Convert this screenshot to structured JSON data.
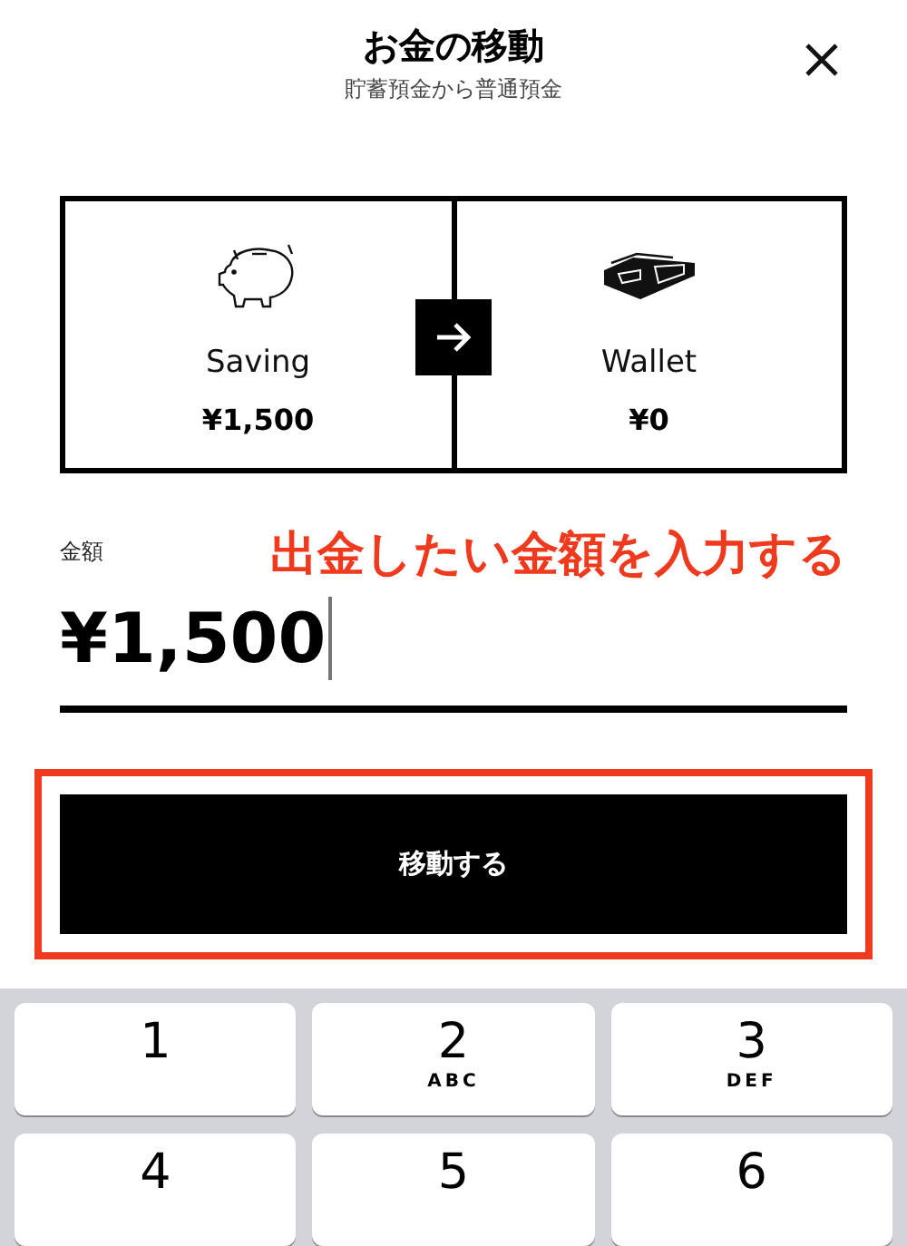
{
  "header": {
    "title": "お金の移動",
    "subtitle": "貯蓄預金から普通預金"
  },
  "transfer": {
    "from": {
      "name": "Saving",
      "amount": "¥1,500"
    },
    "to": {
      "name": "Wallet",
      "amount": "¥0"
    }
  },
  "amount_field": {
    "label": "金額",
    "value": "¥1,500"
  },
  "annotation": {
    "text": "出金したい金額を入力する"
  },
  "submit_button": {
    "label": "移動する"
  },
  "keypad": [
    {
      "digit": "1"
    },
    {
      "digit": "2",
      "letters": "ABC"
    },
    {
      "digit": "3",
      "letters": "DEF"
    },
    {
      "digit": "4"
    },
    {
      "digit": "5"
    },
    {
      "digit": "6"
    }
  ]
}
